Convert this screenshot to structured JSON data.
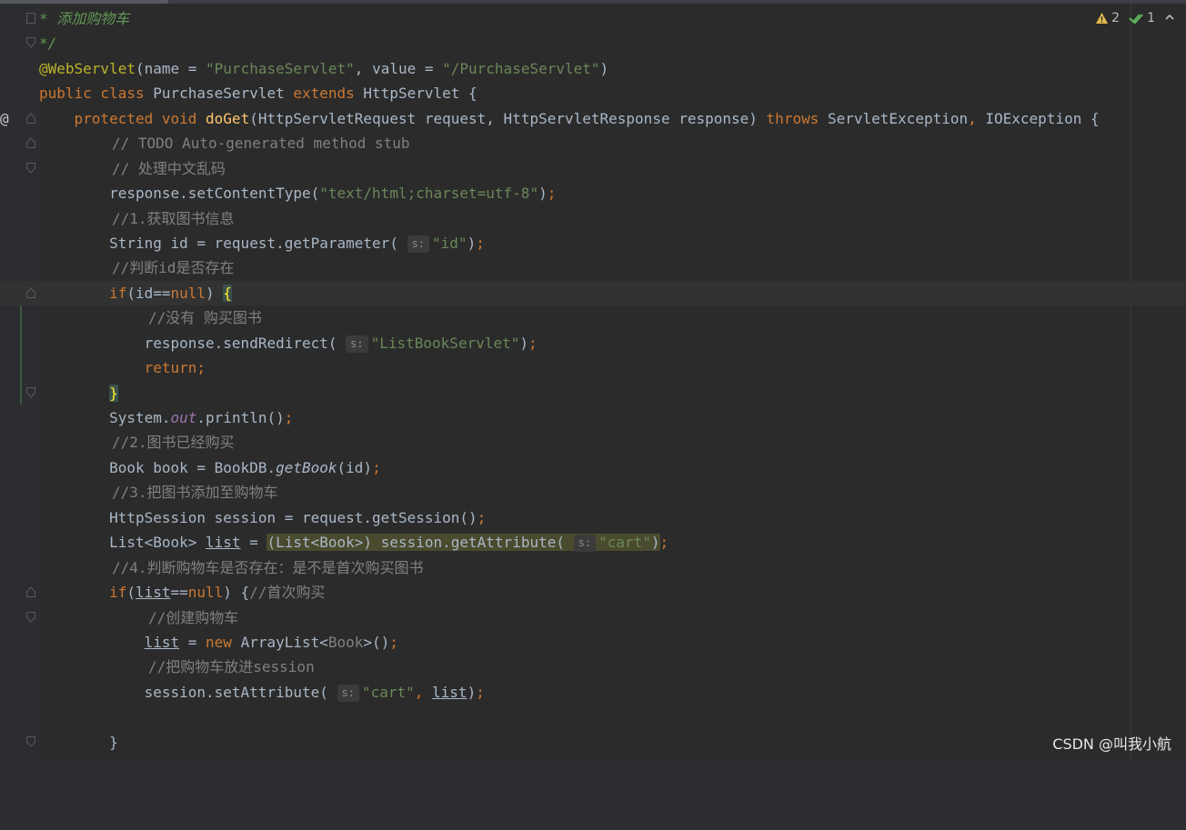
{
  "status": {
    "warnings_count": "2",
    "checks_count": "1",
    "warning_color": "#e5b94b",
    "check_color": "#5fb85f"
  },
  "code_lines": [
    "* 添加购物车",
    "*/",
    "@WebServlet(name = \"PurchaseServlet\", value = \"/PurchaseServlet\")",
    "public class PurchaseServlet extends HttpServlet {",
    "protected void doGet(HttpServletRequest request, HttpServletResponse response) throws ServletException, IOException {",
    "// TODO Auto-generated method stub",
    "// 处理中文乱码",
    "response.setContentType(\"text/html;charset=utf-8\");",
    "//1.获取图书信息",
    "String id = request.getParameter( s: \"id\");",
    "//判断id是否存在",
    "if(id==null) {",
    "//没有 购买图书",
    "response.sendRedirect( s: \"ListBookServlet\");",
    "return;",
    "}",
    "System.out.println();",
    "//2.图书已经购买",
    "Book book = BookDB.getBook(id);",
    "//3.把图书添加至购物车",
    "HttpSession session = request.getSession();",
    "List<Book> list = (List<Book>) session.getAttribute( s: \"cart\");",
    "//4.判断购物车是否存在：是不是首次购买图书",
    "if(list==null) {//首次购买",
    "//创建购物车",
    "list = new ArrayList<Book>();",
    "//把购物车放进session",
    "session.setAttribute( s: \"cart\", list);",
    "",
    "}"
  ],
  "watermark": "CSDN @叫我小航"
}
